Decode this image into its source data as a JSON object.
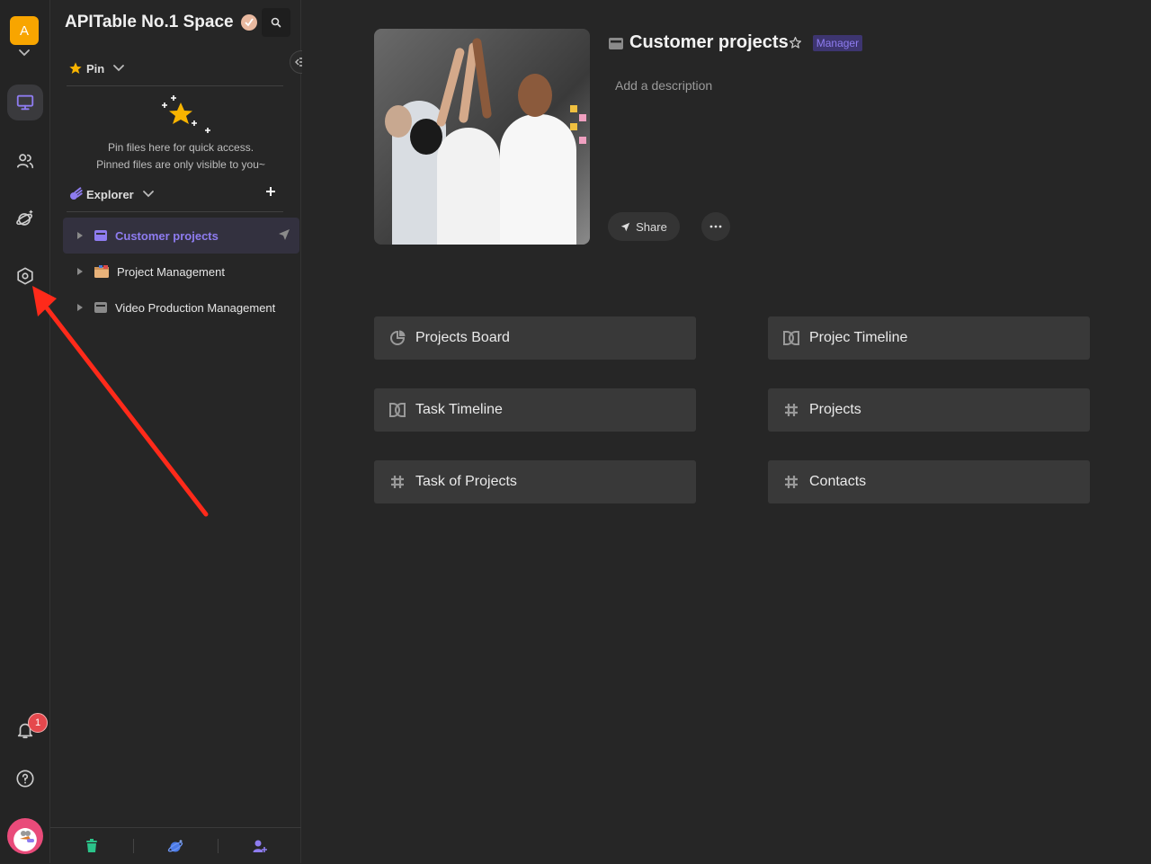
{
  "rail": {
    "space_initial": "A",
    "items": [
      {
        "name": "workbench",
        "active": true
      },
      {
        "name": "contacts"
      },
      {
        "name": "templates"
      },
      {
        "name": "management"
      }
    ],
    "notification_count": "1"
  },
  "sidebar": {
    "space_name": "APITable No.1 Space",
    "pin": {
      "label": "Pin",
      "empty_line1": "Pin files here for quick access.",
      "empty_line2": "Pinned files are only visible to you~"
    },
    "explorer": {
      "label": "Explorer",
      "add_label": "+"
    },
    "tree": [
      {
        "label": "Customer projects",
        "icon": "folder-icon",
        "active": true
      },
      {
        "label": "Project Management",
        "icon": "folder-emoji-icon"
      },
      {
        "label": "Video Production Management",
        "icon": "folder-icon"
      }
    ],
    "footer": [
      "trash",
      "templates",
      "invite-member"
    ]
  },
  "main": {
    "folder_title": "Customer projects",
    "role": "Manager",
    "description_placeholder": "Add a description",
    "share_label": "Share",
    "more_label": "···",
    "nodes": [
      {
        "label": "Projects Board",
        "icon": "dashboard-icon"
      },
      {
        "label": "Projec Timeline",
        "icon": "gantt-icon"
      },
      {
        "label": "Task Timeline",
        "icon": "gantt-icon"
      },
      {
        "label": "Projects",
        "icon": "datasheet-icon"
      },
      {
        "label": "Task of Projects",
        "icon": "datasheet-icon"
      },
      {
        "label": "Contacts",
        "icon": "datasheet-icon"
      }
    ]
  },
  "colors": {
    "accent": "#8e7cf0",
    "space_logo": "#f8a500",
    "badge": "#e5484d",
    "arrow": "#ff2a1a"
  }
}
